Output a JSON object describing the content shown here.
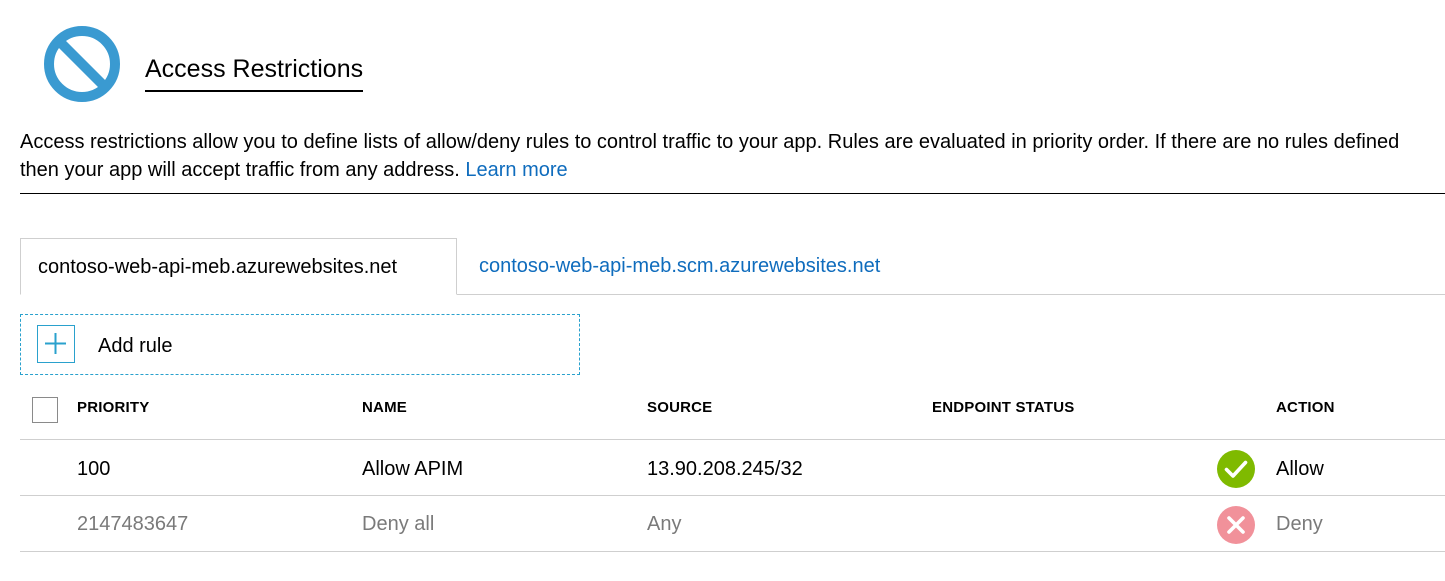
{
  "header": {
    "icon": "blocked-circle-icon",
    "title": "Access Restrictions"
  },
  "description": {
    "line1": "Access restrictions allow you to define lists of allow/deny rules to control traffic to your app. Rules are evaluated in priority order. If there are no rules defined",
    "line2": "then your app will accept traffic from any address.",
    "learn_more": "Learn more"
  },
  "tabs": [
    {
      "label": "contoso-web-api-meb.azurewebsites.net",
      "active": true
    },
    {
      "label": "contoso-web-api-meb.scm.azurewebsites.net",
      "active": false
    }
  ],
  "add_rule": {
    "icon": "plus-icon",
    "label": "Add rule"
  },
  "table": {
    "columns": {
      "priority": "PRIORITY",
      "name": "NAME",
      "source": "SOURCE",
      "endpoint_status": "ENDPOINT STATUS",
      "action": "ACTION"
    },
    "rows": [
      {
        "priority": "100",
        "name": "Allow APIM",
        "source": "13.90.208.245/32",
        "endpoint_status": "",
        "action": "Allow",
        "action_icon": "checkmark-circle-icon",
        "action_color": "#7fba00"
      },
      {
        "priority": "2147483647",
        "name": "Deny all",
        "source": "Any",
        "endpoint_status": "",
        "action": "Deny",
        "action_icon": "x-circle-icon",
        "action_color": "#f1919a"
      }
    ]
  },
  "colors": {
    "accent_icon": "#3a9ad1",
    "link": "#0f6cbd",
    "dashed_border": "#2aa1cd",
    "allow": "#7fba00",
    "deny": "#f1919a"
  }
}
